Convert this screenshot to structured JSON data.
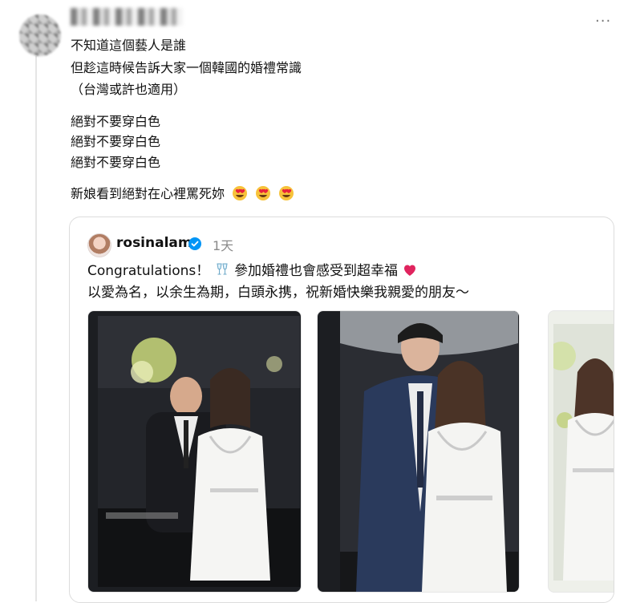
{
  "post": {
    "more_label": "···",
    "lines": [
      "不知道這個藝人是誰",
      "但趁這時候告訴大家一個韓國的婚禮常識",
      "（台灣或許也適用）",
      "絕對不要穿白色",
      "絕對不要穿白色",
      "絕對不要穿白色",
      "新娘看到絕對在心裡罵死妳"
    ]
  },
  "quote": {
    "username": "rosinalam",
    "time": "1天",
    "line1_text": "Congratulations！",
    "line1_text2": "參加婚禮也會感受到超幸福",
    "line2": "以愛為名，以余生為期，白頭永携，祝新婚快樂我親愛的朋友～",
    "verified_color": "#0095f6",
    "heart_color": "#e0245e"
  },
  "colors": {
    "thread_line": "#e5e5e5",
    "quote_border": "#dcdcdc",
    "secondary_text": "#8a8a8a"
  }
}
